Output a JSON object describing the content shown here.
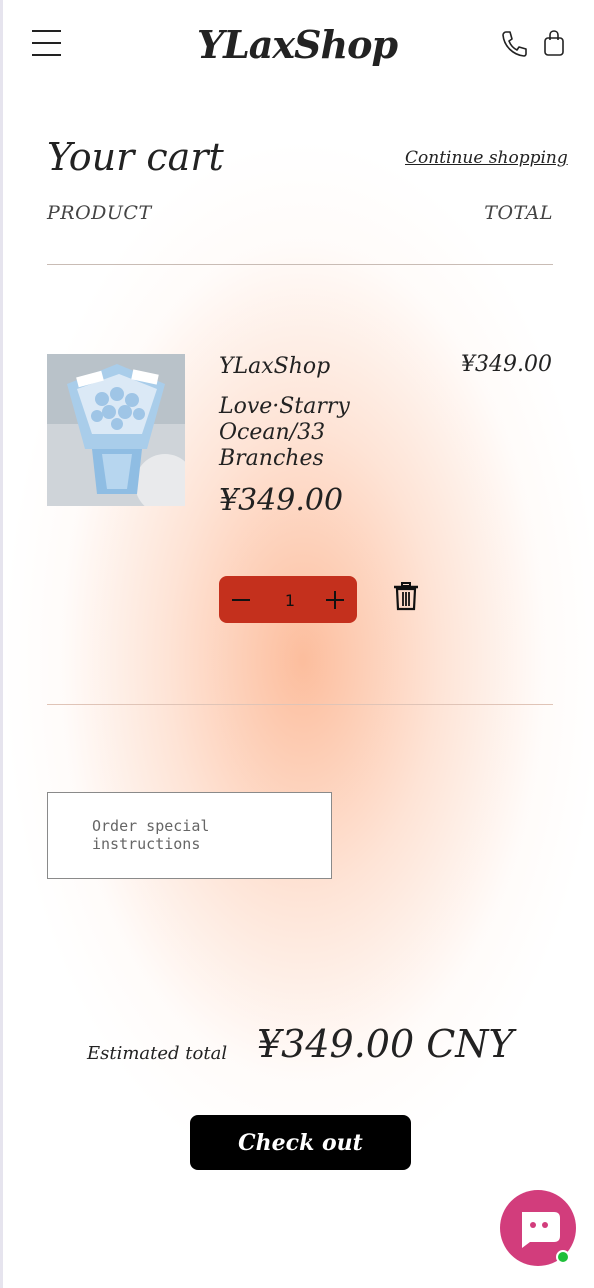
{
  "header": {
    "logo": "YLaxShop",
    "icons": [
      "menu-icon",
      "phone-icon",
      "bag-icon"
    ]
  },
  "cart": {
    "title": "Your cart",
    "continue_link": "Continue shopping",
    "columns": {
      "product": "PRODUCT",
      "total": "TOTAL"
    },
    "item": {
      "vendor": "YLaxShop",
      "name": "Love·Starry Ocean/33 Branches",
      "price": "¥349.00",
      "line_total": "¥349.00",
      "quantity": "1"
    }
  },
  "note": {
    "placeholder": "Order special instructions"
  },
  "summary": {
    "estimated_label": "Estimated total",
    "estimated_value": "¥349.00 CNY",
    "checkout_label": "Check out"
  },
  "colors": {
    "accent": "#c4301d",
    "chat": "#d23d7c",
    "online": "#1fbf3a",
    "checkout_bg": "#000000"
  }
}
